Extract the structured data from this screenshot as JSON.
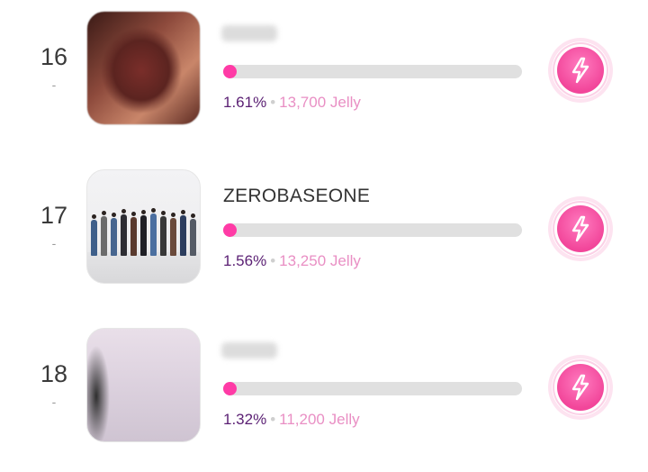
{
  "colors": {
    "accent_pink": "#ff3ba6",
    "percent_purple": "#5a1f73",
    "jelly_pink": "#e98fc4",
    "track_gray": "#e0e0e0"
  },
  "entries": [
    {
      "rank": "16",
      "change": "-",
      "name": "",
      "name_obscured": true,
      "progress_fraction": 0.0161,
      "percent": "1.61%",
      "jelly": "13,700 Jelly",
      "vote_icon": "lightning-bolt-icon"
    },
    {
      "rank": "17",
      "change": "-",
      "name": "ZEROBASEONE",
      "name_obscured": false,
      "progress_fraction": 0.0156,
      "percent": "1.56%",
      "jelly": "13,250 Jelly",
      "vote_icon": "lightning-bolt-icon"
    },
    {
      "rank": "18",
      "change": "-",
      "name": "",
      "name_obscured": true,
      "progress_fraction": 0.0132,
      "percent": "1.32%",
      "jelly": "11,200 Jelly",
      "vote_icon": "lightning-bolt-icon"
    }
  ]
}
